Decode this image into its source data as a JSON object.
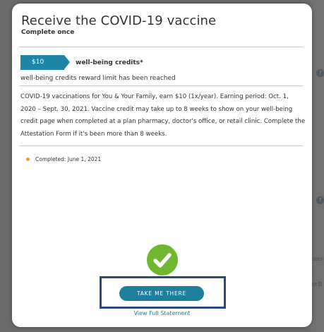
{
  "background": {
    "help_glyph": "?",
    "side_text_1": "ates",
    "side_text_2": "nt B"
  },
  "modal": {
    "title": "Receive the COVID-19 vaccine",
    "subtitle": "Complete once",
    "credit_amount": "$10",
    "credit_label": "well-being credits*",
    "limit_message": "well-being credits reward limit has been reached",
    "description": "COVID-19 vaccinations for You & Your Family, earn $10 (1x/year). Earning period: Oct. 1, 2020 – Sept. 30, 2021. Vaccine credit may take up to 8 weeks to show on your well-being credit page when completed at a plan pharmacy, doctor's office, or retail clinic. Complete the Attestation Form if it's been more than 8 weeks.",
    "completed_text": "Completed: June 1, 2021",
    "cta_label": "TAKE ME THERE",
    "view_statement_label": "View Full Statement"
  },
  "colors": {
    "accent": "#1d86a6",
    "button": "#1d7f9e",
    "success": "#70b72f",
    "status_dot": "#f0a020",
    "highlight_border": "#2a4a7a"
  },
  "icons": {
    "status": "check-circle-icon",
    "bullet": "status-dot-icon",
    "help": "help-icon"
  }
}
